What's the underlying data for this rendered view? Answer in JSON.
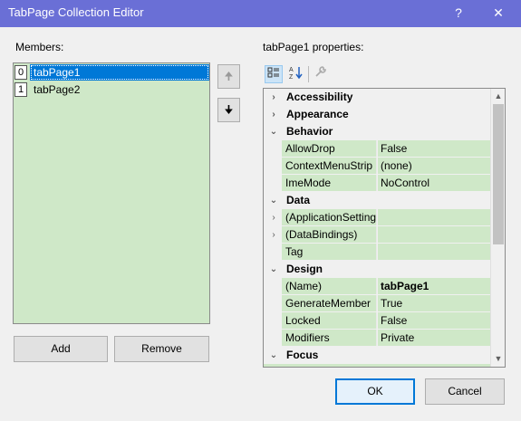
{
  "window": {
    "title": "TabPage Collection Editor",
    "help": "?",
    "close": "✕"
  },
  "members": {
    "label": "Members:",
    "items": [
      {
        "index": "0",
        "name": "tabPage1",
        "selected": true
      },
      {
        "index": "1",
        "name": "tabPage2",
        "selected": false
      }
    ],
    "up_glyph": "🠉",
    "down_glyph": "🠋",
    "add_label": "Add",
    "remove_label": "Remove"
  },
  "properties": {
    "label": "tabPage1 properties:",
    "toolbar": {
      "categorized_icon": "categorized-icon",
      "alphabetical_icon": "alphabetical-icon",
      "property_pages_icon": "wrench-icon"
    },
    "rows": [
      {
        "kind": "cat",
        "name": "Accessibility",
        "expanded": false
      },
      {
        "kind": "cat",
        "name": "Appearance",
        "expanded": false
      },
      {
        "kind": "cat",
        "name": "Behavior",
        "expanded": true
      },
      {
        "kind": "prop",
        "name": "AllowDrop",
        "value": "False"
      },
      {
        "kind": "prop",
        "name": "ContextMenuStrip",
        "value": "(none)"
      },
      {
        "kind": "prop",
        "name": "ImeMode",
        "value": "NoControl"
      },
      {
        "kind": "cat",
        "name": "Data",
        "expanded": true
      },
      {
        "kind": "prop",
        "name": "(ApplicationSettings)",
        "value": "",
        "expandable": true
      },
      {
        "kind": "prop",
        "name": "(DataBindings)",
        "value": "",
        "expandable": true
      },
      {
        "kind": "prop",
        "name": "Tag",
        "value": ""
      },
      {
        "kind": "cat",
        "name": "Design",
        "expanded": true
      },
      {
        "kind": "prop",
        "name": "(Name)",
        "value": "tabPage1",
        "bold": true
      },
      {
        "kind": "prop",
        "name": "GenerateMember",
        "value": "True"
      },
      {
        "kind": "prop",
        "name": "Locked",
        "value": "False"
      },
      {
        "kind": "prop",
        "name": "Modifiers",
        "value": "Private"
      },
      {
        "kind": "cat",
        "name": "Focus",
        "expanded": true
      }
    ]
  },
  "buttons": {
    "ok": "OK",
    "cancel": "Cancel"
  }
}
